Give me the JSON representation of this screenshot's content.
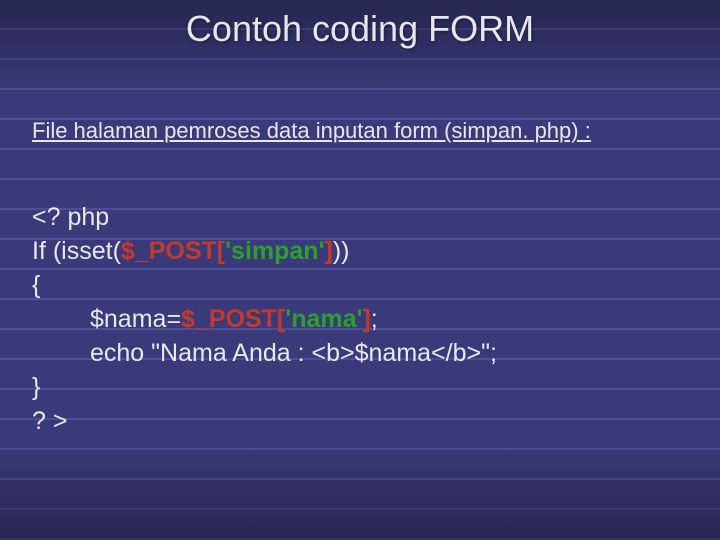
{
  "title": "Contoh coding FORM",
  "subtitle": "File halaman pemroses data inputan form (simpan. php) :",
  "code": {
    "l1": "<? php",
    "l2a": "If (isset(",
    "l2b": "$_POST[",
    "l2c": "'simpan'",
    "l2d": "]",
    "l2e": "))",
    "l3": "{",
    "l4a": "$nama=",
    "l4b": "$_POST[",
    "l4c": "'nama'",
    "l4d": "]",
    "l4e": ";",
    "l5": "echo \"Nama Anda : <b>$nama</b>\";",
    "l6": "}",
    "l7": "? >"
  }
}
